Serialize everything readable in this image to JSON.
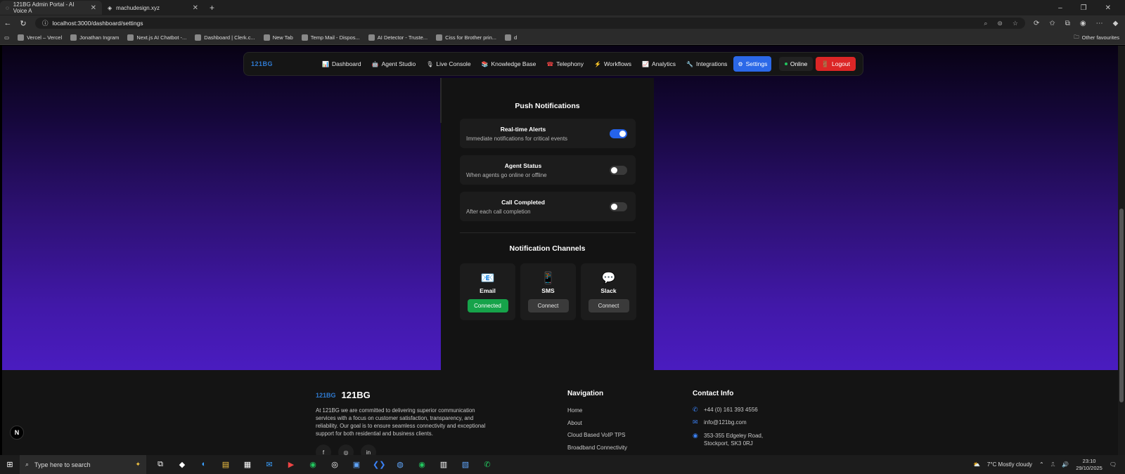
{
  "browser": {
    "tabs": [
      {
        "title": "121BG Admin Portal - AI Voice A",
        "active": true
      },
      {
        "title": "machudesign.xyz",
        "active": false
      }
    ],
    "new_tab": "+",
    "url": "localhost:3000/dashboard/settings",
    "bookmarks": [
      "Vercel – Vercel",
      "Jonathan Ingram",
      "Next.js AI Chatbot -...",
      "Dashboard | Clerk.c...",
      "New Tab",
      "Temp Mail - Dispos...",
      "AI Detector - Truste...",
      "Ciss for Brother prin...",
      "d"
    ],
    "other_favourites": "Other favourites"
  },
  "app": {
    "logo": "121BG",
    "nav": [
      {
        "label": "Dashboard",
        "icon": "📊"
      },
      {
        "label": "Agent Studio",
        "icon": "🤖"
      },
      {
        "label": "Live Console",
        "icon": "🎙"
      },
      {
        "label": "Knowledge Base",
        "icon": "📚"
      },
      {
        "label": "Telephony",
        "icon": "☎"
      },
      {
        "label": "Workflows",
        "icon": "⚡"
      },
      {
        "label": "Analytics",
        "icon": "📈"
      },
      {
        "label": "Integrations",
        "icon": "🔧"
      },
      {
        "label": "Settings",
        "icon": "⚙"
      }
    ],
    "status": "Online",
    "logout": "Logout"
  },
  "settings": {
    "push_title": "Push Notifications",
    "items": [
      {
        "title": "Real-time Alerts",
        "subtitle": "Immediate notifications for critical events",
        "enabled": true
      },
      {
        "title": "Agent Status",
        "subtitle": "When agents go online or offline",
        "enabled": false
      },
      {
        "title": "Call Completed",
        "subtitle": "After each call completion",
        "enabled": false
      }
    ],
    "channels_title": "Notification Channels",
    "channels": [
      {
        "name": "Email",
        "icon": "📧",
        "action": "Connected",
        "connected": true
      },
      {
        "name": "SMS",
        "icon": "📱",
        "action": "Connect",
        "connected": false
      },
      {
        "name": "Slack",
        "icon": "💬",
        "action": "Connect",
        "connected": false
      }
    ]
  },
  "footer": {
    "logo_mark": "121BG",
    "brand": "121BG",
    "description": "At 121BG we are committed to delivering superior communication services with a focus on customer satisfaction, transparency, and reliability. Our goal is to ensure seamless connectivity and exceptional support for both residential and business clients.",
    "nav_title": "Navigation",
    "nav_links": [
      "Home",
      "About",
      "Cloud Based VoIP TPS",
      "Broadband Connectivity"
    ],
    "contact_title": "Contact Info",
    "phone": "+44 (0) 161 393 4556",
    "email": "info@121bg.com",
    "address_line1": "353-355 Edgeley Road,",
    "address_line2": "Stockport, SK3 0RJ"
  },
  "taskbar": {
    "search_placeholder": "Type here to search",
    "weather": "7°C  Mostly cloudy",
    "time": "23:10",
    "date": "29/10/2025"
  }
}
